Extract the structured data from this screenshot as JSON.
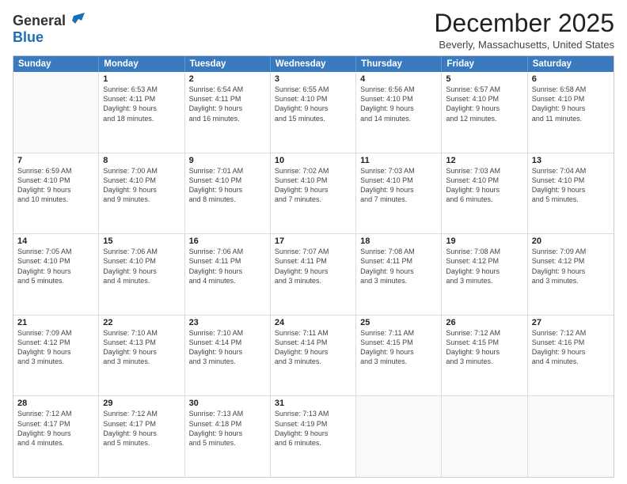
{
  "header": {
    "logo_general": "General",
    "logo_blue": "Blue",
    "month_title": "December 2025",
    "location": "Beverly, Massachusetts, United States"
  },
  "days_of_week": [
    "Sunday",
    "Monday",
    "Tuesday",
    "Wednesday",
    "Thursday",
    "Friday",
    "Saturday"
  ],
  "weeks": [
    [
      {
        "day": "",
        "empty": true
      },
      {
        "day": "1",
        "line1": "Sunrise: 6:53 AM",
        "line2": "Sunset: 4:11 PM",
        "line3": "Daylight: 9 hours",
        "line4": "and 18 minutes."
      },
      {
        "day": "2",
        "line1": "Sunrise: 6:54 AM",
        "line2": "Sunset: 4:11 PM",
        "line3": "Daylight: 9 hours",
        "line4": "and 16 minutes."
      },
      {
        "day": "3",
        "line1": "Sunrise: 6:55 AM",
        "line2": "Sunset: 4:10 PM",
        "line3": "Daylight: 9 hours",
        "line4": "and 15 minutes."
      },
      {
        "day": "4",
        "line1": "Sunrise: 6:56 AM",
        "line2": "Sunset: 4:10 PM",
        "line3": "Daylight: 9 hours",
        "line4": "and 14 minutes."
      },
      {
        "day": "5",
        "line1": "Sunrise: 6:57 AM",
        "line2": "Sunset: 4:10 PM",
        "line3": "Daylight: 9 hours",
        "line4": "and 12 minutes."
      },
      {
        "day": "6",
        "line1": "Sunrise: 6:58 AM",
        "line2": "Sunset: 4:10 PM",
        "line3": "Daylight: 9 hours",
        "line4": "and 11 minutes."
      }
    ],
    [
      {
        "day": "7",
        "line1": "Sunrise: 6:59 AM",
        "line2": "Sunset: 4:10 PM",
        "line3": "Daylight: 9 hours",
        "line4": "and 10 minutes."
      },
      {
        "day": "8",
        "line1": "Sunrise: 7:00 AM",
        "line2": "Sunset: 4:10 PM",
        "line3": "Daylight: 9 hours",
        "line4": "and 9 minutes."
      },
      {
        "day": "9",
        "line1": "Sunrise: 7:01 AM",
        "line2": "Sunset: 4:10 PM",
        "line3": "Daylight: 9 hours",
        "line4": "and 8 minutes."
      },
      {
        "day": "10",
        "line1": "Sunrise: 7:02 AM",
        "line2": "Sunset: 4:10 PM",
        "line3": "Daylight: 9 hours",
        "line4": "and 7 minutes."
      },
      {
        "day": "11",
        "line1": "Sunrise: 7:03 AM",
        "line2": "Sunset: 4:10 PM",
        "line3": "Daylight: 9 hours",
        "line4": "and 7 minutes."
      },
      {
        "day": "12",
        "line1": "Sunrise: 7:03 AM",
        "line2": "Sunset: 4:10 PM",
        "line3": "Daylight: 9 hours",
        "line4": "and 6 minutes."
      },
      {
        "day": "13",
        "line1": "Sunrise: 7:04 AM",
        "line2": "Sunset: 4:10 PM",
        "line3": "Daylight: 9 hours",
        "line4": "and 5 minutes."
      }
    ],
    [
      {
        "day": "14",
        "line1": "Sunrise: 7:05 AM",
        "line2": "Sunset: 4:10 PM",
        "line3": "Daylight: 9 hours",
        "line4": "and 5 minutes."
      },
      {
        "day": "15",
        "line1": "Sunrise: 7:06 AM",
        "line2": "Sunset: 4:10 PM",
        "line3": "Daylight: 9 hours",
        "line4": "and 4 minutes."
      },
      {
        "day": "16",
        "line1": "Sunrise: 7:06 AM",
        "line2": "Sunset: 4:11 PM",
        "line3": "Daylight: 9 hours",
        "line4": "and 4 minutes."
      },
      {
        "day": "17",
        "line1": "Sunrise: 7:07 AM",
        "line2": "Sunset: 4:11 PM",
        "line3": "Daylight: 9 hours",
        "line4": "and 3 minutes."
      },
      {
        "day": "18",
        "line1": "Sunrise: 7:08 AM",
        "line2": "Sunset: 4:11 PM",
        "line3": "Daylight: 9 hours",
        "line4": "and 3 minutes."
      },
      {
        "day": "19",
        "line1": "Sunrise: 7:08 AM",
        "line2": "Sunset: 4:12 PM",
        "line3": "Daylight: 9 hours",
        "line4": "and 3 minutes."
      },
      {
        "day": "20",
        "line1": "Sunrise: 7:09 AM",
        "line2": "Sunset: 4:12 PM",
        "line3": "Daylight: 9 hours",
        "line4": "and 3 minutes."
      }
    ],
    [
      {
        "day": "21",
        "line1": "Sunrise: 7:09 AM",
        "line2": "Sunset: 4:12 PM",
        "line3": "Daylight: 9 hours",
        "line4": "and 3 minutes."
      },
      {
        "day": "22",
        "line1": "Sunrise: 7:10 AM",
        "line2": "Sunset: 4:13 PM",
        "line3": "Daylight: 9 hours",
        "line4": "and 3 minutes."
      },
      {
        "day": "23",
        "line1": "Sunrise: 7:10 AM",
        "line2": "Sunset: 4:14 PM",
        "line3": "Daylight: 9 hours",
        "line4": "and 3 minutes."
      },
      {
        "day": "24",
        "line1": "Sunrise: 7:11 AM",
        "line2": "Sunset: 4:14 PM",
        "line3": "Daylight: 9 hours",
        "line4": "and 3 minutes."
      },
      {
        "day": "25",
        "line1": "Sunrise: 7:11 AM",
        "line2": "Sunset: 4:15 PM",
        "line3": "Daylight: 9 hours",
        "line4": "and 3 minutes."
      },
      {
        "day": "26",
        "line1": "Sunrise: 7:12 AM",
        "line2": "Sunset: 4:15 PM",
        "line3": "Daylight: 9 hours",
        "line4": "and 3 minutes."
      },
      {
        "day": "27",
        "line1": "Sunrise: 7:12 AM",
        "line2": "Sunset: 4:16 PM",
        "line3": "Daylight: 9 hours",
        "line4": "and 4 minutes."
      }
    ],
    [
      {
        "day": "28",
        "line1": "Sunrise: 7:12 AM",
        "line2": "Sunset: 4:17 PM",
        "line3": "Daylight: 9 hours",
        "line4": "and 4 minutes."
      },
      {
        "day": "29",
        "line1": "Sunrise: 7:12 AM",
        "line2": "Sunset: 4:17 PM",
        "line3": "Daylight: 9 hours",
        "line4": "and 5 minutes."
      },
      {
        "day": "30",
        "line1": "Sunrise: 7:13 AM",
        "line2": "Sunset: 4:18 PM",
        "line3": "Daylight: 9 hours",
        "line4": "and 5 minutes."
      },
      {
        "day": "31",
        "line1": "Sunrise: 7:13 AM",
        "line2": "Sunset: 4:19 PM",
        "line3": "Daylight: 9 hours",
        "line4": "and 6 minutes."
      },
      {
        "day": "",
        "empty": true
      },
      {
        "day": "",
        "empty": true
      },
      {
        "day": "",
        "empty": true
      }
    ]
  ]
}
